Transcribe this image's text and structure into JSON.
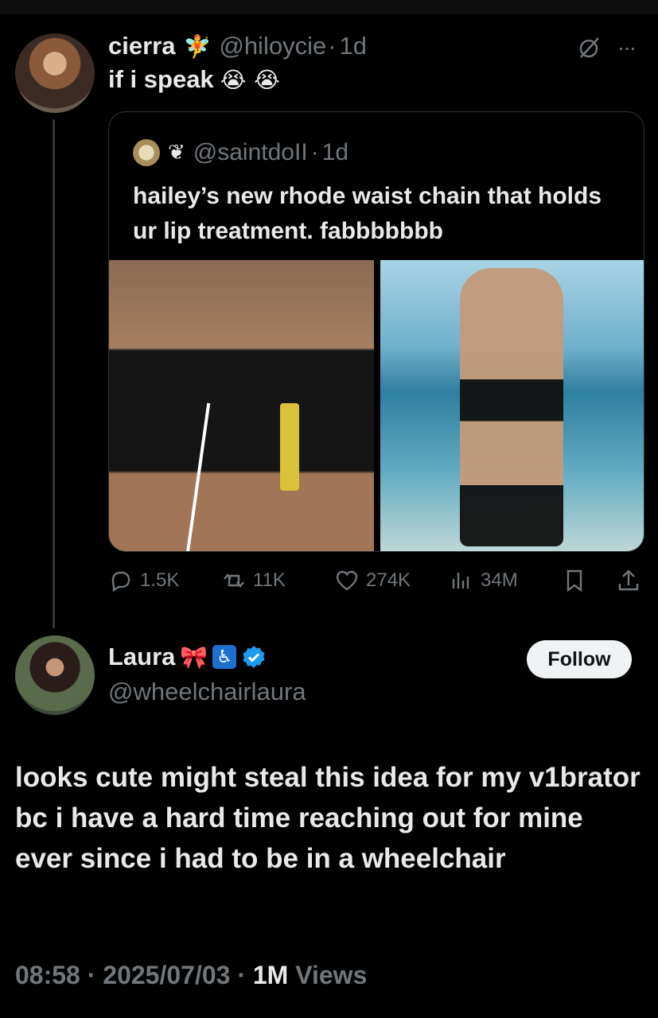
{
  "tweet": {
    "author_name": "cierra",
    "author_emoji": "🧚",
    "handle": "@hiloycie",
    "dot": "·",
    "age": "1d",
    "text": "if i speak",
    "text_emojis": "😭 😭"
  },
  "quote": {
    "handle": "@saintdoII",
    "handle_prefix_emoji": "❦",
    "dot": "·",
    "age": "1d",
    "text": "hailey’s new rhode waist chain that holds ur lip treatment. fabbbbbbb"
  },
  "actions": {
    "replies": "1.5K",
    "reposts": "11K",
    "likes": "274K",
    "views": "34M"
  },
  "reply": {
    "name": "Laura",
    "name_emoji": "🎀",
    "access_symbol": "♿",
    "handle": "@wheelchairlaura",
    "follow_label": "Follow",
    "text": "looks cute might steal this idea for my v1brator bc i have a hard time reaching out for mine ever since i had to be in a wheelchair",
    "time": "08:58",
    "date": "2025/07/03",
    "views_count": "1M",
    "views_label": "Views",
    "sep": "·"
  },
  "icons": {
    "verified_color": "#1d9bf0",
    "muted_text_color": "#71767b"
  }
}
